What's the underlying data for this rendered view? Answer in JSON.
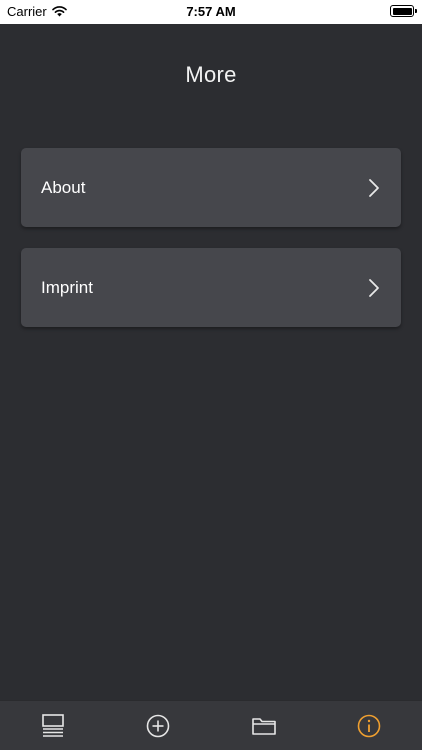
{
  "status_bar": {
    "carrier": "Carrier",
    "time": "7:57 AM",
    "wifi_icon": "wifi-icon",
    "battery_icon": "battery-icon"
  },
  "page": {
    "title": "More"
  },
  "menu": {
    "items": [
      {
        "label": "About",
        "icon": "chevron-right-icon"
      },
      {
        "label": "Imprint",
        "icon": "chevron-right-icon"
      }
    ]
  },
  "tab_bar": {
    "tabs": [
      {
        "icon": "list-layout-icon",
        "selected": false
      },
      {
        "icon": "add-circle-icon",
        "selected": false
      },
      {
        "icon": "folder-icon",
        "selected": false
      },
      {
        "icon": "info-circle-icon",
        "selected": true
      }
    ]
  },
  "colors": {
    "background": "#2c2d31",
    "row_background": "#46474c",
    "tab_bar_background": "#37383c",
    "accent": "#f0a030",
    "icon_default": "#e6e6e6"
  }
}
